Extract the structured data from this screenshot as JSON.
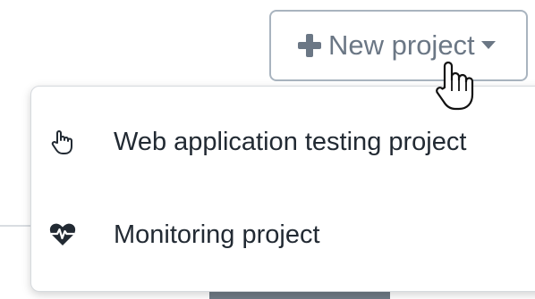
{
  "button": {
    "label": "New project",
    "icon": "plus-icon",
    "caret_icon": "caret-down-icon",
    "color": "#6b7785"
  },
  "menu": {
    "items": [
      {
        "label": "Web application testing project",
        "icon": "pointer-hand-icon"
      },
      {
        "label": "Monitoring project",
        "icon": "heartbeat-icon"
      }
    ]
  },
  "colors": {
    "text": "#222a33",
    "border": "#a9b4bf"
  }
}
